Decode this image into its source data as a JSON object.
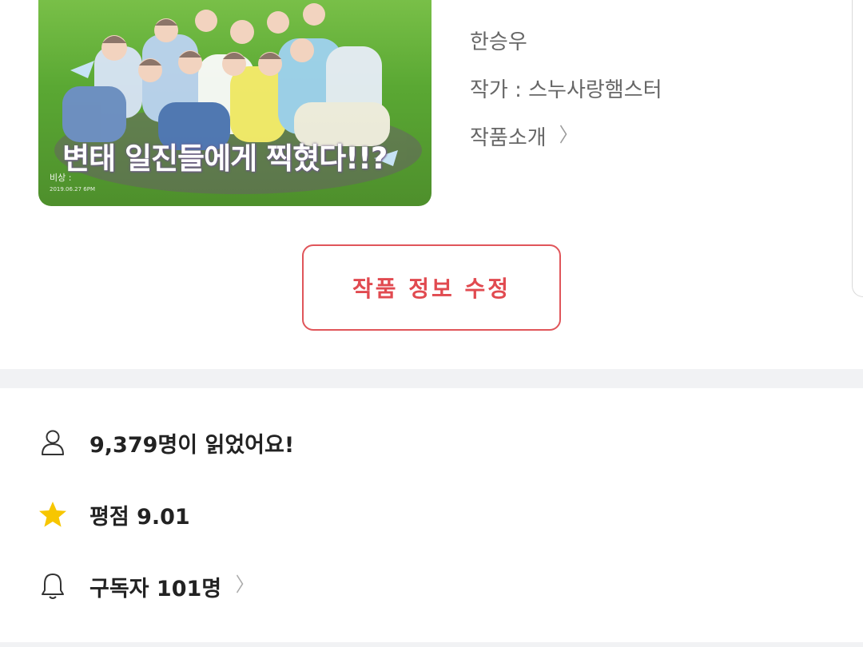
{
  "work": {
    "cover_title": "변태 일진들에게 찍혔다!!?",
    "cover_caption": "비상 :",
    "cover_date": "2019.06.27 6PM",
    "author_name": "한승우",
    "author_line": "작가 : 스누사랑햄스터",
    "intro_label": "작품소개"
  },
  "actions": {
    "edit_label": "작품 정보 수정"
  },
  "stats": {
    "readers": "9,379명이 읽었어요!",
    "rating": "평점 9.01",
    "subscribers": "구독자 101명"
  },
  "icons": {
    "readers": "person-icon",
    "rating": "star-icon",
    "subscribers": "bell-icon",
    "chevron": "chevron-right-icon"
  },
  "colors": {
    "accent": "#e0555a",
    "star": "#f7c600",
    "divider": "#f1f2f4"
  }
}
